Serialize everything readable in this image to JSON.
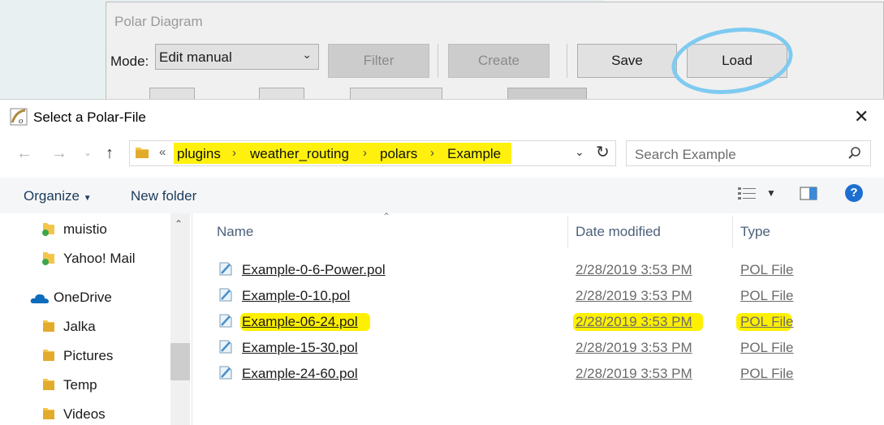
{
  "polar_window": {
    "title": "Polar Diagram",
    "mode_label": "Mode:",
    "mode_value": "Edit manual",
    "buttons": {
      "filter": "Filter",
      "create": "Create",
      "save": "Save",
      "load": "Load"
    }
  },
  "dialog": {
    "title": "Select a Polar-File",
    "breadcrumb": [
      "plugins",
      "weather_routing",
      "polars",
      "Example"
    ],
    "search_placeholder": "Search Example",
    "toolbar": {
      "organize": "Organize",
      "new_folder": "New folder"
    },
    "nav_items": [
      "muistio",
      "Yahoo! Mail",
      "OneDrive",
      "Jalka",
      "Pictures",
      "Temp",
      "Videos"
    ],
    "columns": {
      "name": "Name",
      "date": "Date modified",
      "type": "Type"
    },
    "files": [
      {
        "name": "Example-0-6-Power.pol",
        "date": "2/28/2019 3:53 PM",
        "type": "POL File"
      },
      {
        "name": "Example-0-10.pol",
        "date": "2/28/2019 3:53 PM",
        "type": "POL File"
      },
      {
        "name": "Example-06-24.pol",
        "date": "2/28/2019 3:53 PM",
        "type": "POL File"
      },
      {
        "name": "Example-15-30.pol",
        "date": "2/28/2019 3:53 PM",
        "type": "POL File"
      },
      {
        "name": "Example-24-60.pol",
        "date": "2/28/2019 3:53 PM",
        "type": "POL File"
      }
    ]
  },
  "colors": {
    "highlight": "#fff000",
    "load_circle": "#7fcaf0",
    "accent": "#1c6fd0"
  }
}
